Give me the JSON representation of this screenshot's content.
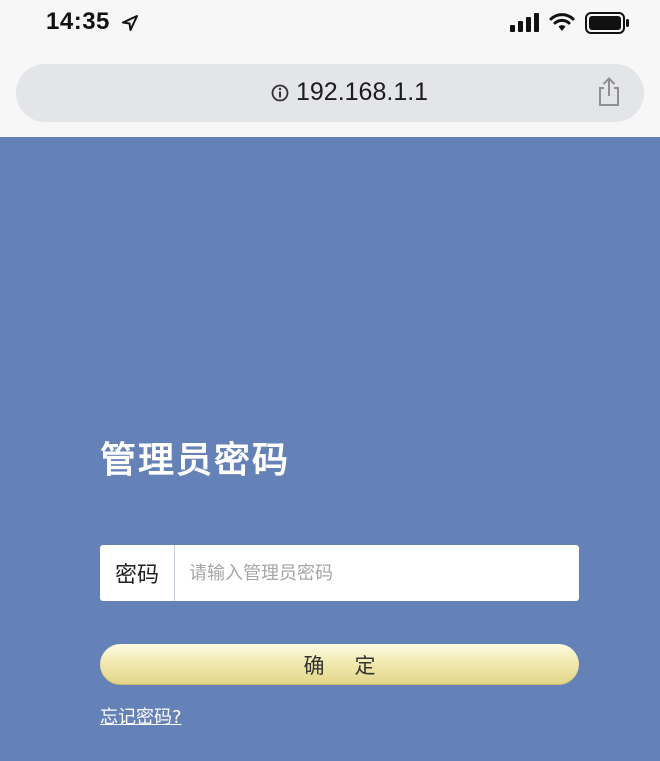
{
  "status_bar": {
    "time": "14:35",
    "icons": [
      "location-arrow-icon",
      "cellular-signal-icon",
      "wifi-icon",
      "battery-icon"
    ]
  },
  "address_bar": {
    "url": "192.168.1.1",
    "icons": [
      "info-icon",
      "share-icon"
    ]
  },
  "login": {
    "title": "管理员密码",
    "password_label": "密码",
    "password_placeholder": "请输入管理员密码",
    "password_value": "",
    "confirm_label": "确定",
    "forgot_link": "忘记密码?"
  },
  "colors": {
    "background": "#6482b8",
    "button": "#f1e9b1",
    "chrome": "#f7f7f8"
  }
}
